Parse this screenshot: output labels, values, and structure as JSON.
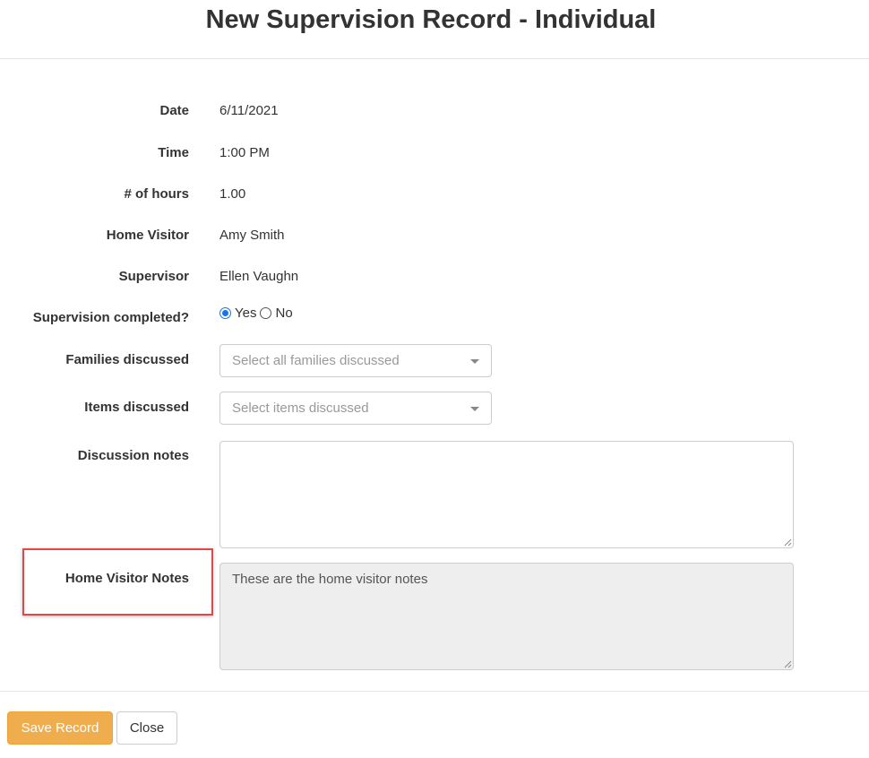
{
  "modal": {
    "title": "New Supervision Record - Individual"
  },
  "fields": {
    "date": {
      "label": "Date",
      "value": "6/11/2021"
    },
    "time": {
      "label": "Time",
      "value": "1:00 PM"
    },
    "hours": {
      "label": "# of hours",
      "value": "1.00"
    },
    "home_visitor": {
      "label": "Home Visitor",
      "value": "Amy Smith"
    },
    "supervisor": {
      "label": "Supervisor",
      "value": "Ellen Vaughn"
    },
    "supervision_completed": {
      "label": "Supervision completed?",
      "options": [
        "Yes",
        "No"
      ],
      "selected": "Yes"
    },
    "families_discussed": {
      "label": "Families discussed",
      "placeholder": "Select all families discussed"
    },
    "items_discussed": {
      "label": "Items discussed",
      "placeholder": "Select items discussed"
    },
    "discussion_notes": {
      "label": "Discussion notes",
      "value": ""
    },
    "home_visitor_notes": {
      "label": "Home Visitor Notes",
      "value": "These are the home visitor notes"
    }
  },
  "footer": {
    "save_label": "Save Record",
    "close_label": "Close"
  },
  "colors": {
    "save_button": "#f0ad4e",
    "highlight_box": "#e0484a",
    "radio_accent": "#1a73e8",
    "readonly_background": "#eeeeee"
  },
  "icons": {
    "dropdown": "caret-down-icon",
    "resize": "resize-grip-icon"
  }
}
